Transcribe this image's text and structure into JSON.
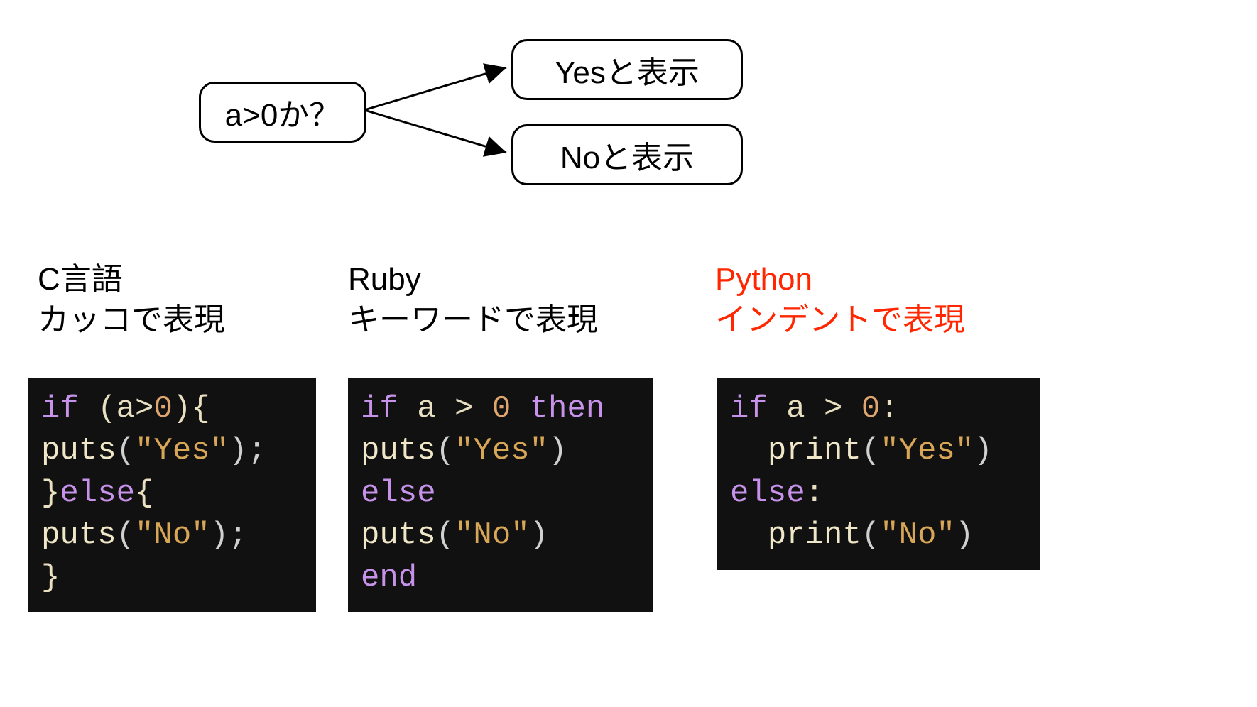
{
  "diagram": {
    "condition": "a>0か？",
    "yes": "Yesと表示",
    "no": "Noと表示"
  },
  "columns": {
    "c": {
      "title1": "C言語",
      "title2": "カッコで表現",
      "code": {
        "l1_if": "if",
        "l1_rest": " (a>",
        "l1_num": "0",
        "l1_brace": "){",
        "l2_fn": "puts",
        "l2_p1": "(",
        "l2_str": "\"Yes\"",
        "l2_p2": ");",
        "l3_pre": "}",
        "l3_else": "else",
        "l3_post": "{",
        "l4_fn": "puts",
        "l4_p1": "(",
        "l4_str": "\"No\"",
        "l4_p2": ");",
        "l5": "}"
      }
    },
    "ruby": {
      "title1": "Ruby",
      "title2": "キーワードで表現",
      "code": {
        "l1_if": "if",
        "l1_mid": " a > ",
        "l1_num": "0",
        "l1_sp": " ",
        "l1_then": "then",
        "l2_fn": "puts",
        "l2_p1": "(",
        "l2_str": "\"Yes\"",
        "l2_p2": ")",
        "l3_else": "else",
        "l4_fn": "puts",
        "l4_p1": "(",
        "l4_str": "\"No\"",
        "l4_p2": ")",
        "l5_end": "end"
      }
    },
    "python": {
      "title1": "Python",
      "title2": "インデントで表現",
      "code": {
        "l1_if": "if",
        "l1_mid": " a > ",
        "l1_num": "0",
        "l1_colon": ":",
        "l2_indent": "  ",
        "l2_fn": "print",
        "l2_p1": "(",
        "l2_str": "\"Yes\"",
        "l2_p2": ")",
        "l3_else": "else",
        "l3_colon": ":",
        "l4_indent": "  ",
        "l4_fn": "print",
        "l4_p1": "(",
        "l4_str": "\"No\"",
        "l4_p2": ")"
      }
    }
  }
}
